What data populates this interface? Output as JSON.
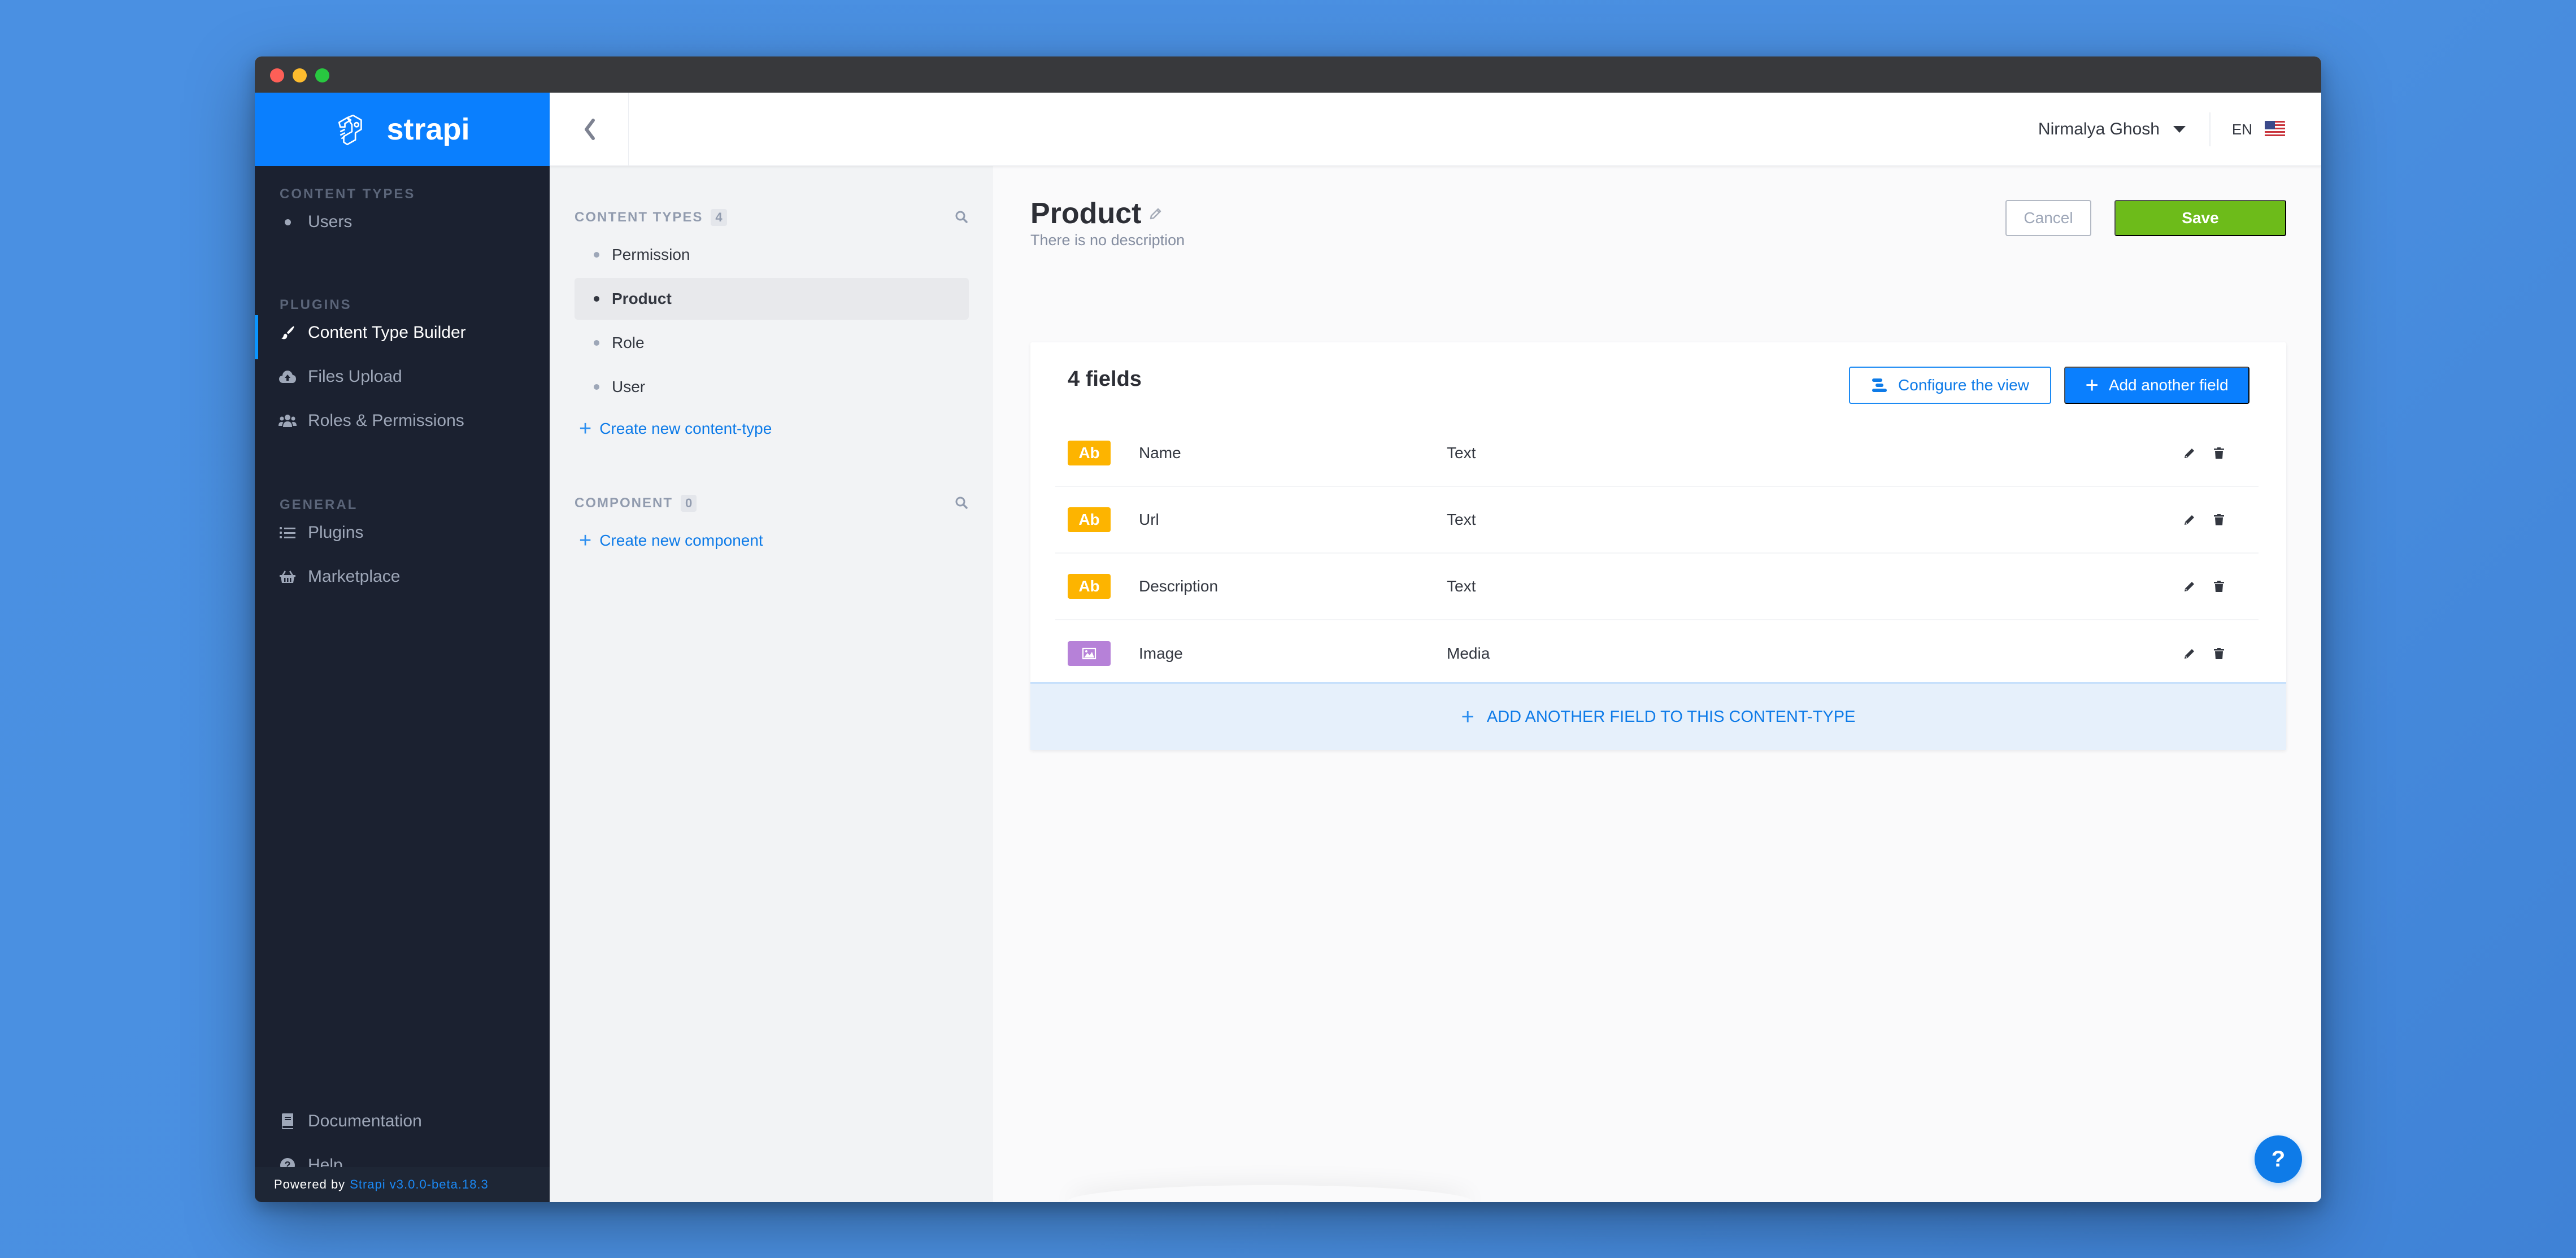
{
  "window": {
    "controls": [
      "close",
      "minimize",
      "maximize"
    ]
  },
  "brand": {
    "name": "strapi",
    "logo_icon": "strapi-logo-icon"
  },
  "sidebar": {
    "sections": [
      {
        "title": "CONTENT TYPES",
        "items": [
          {
            "label": "Users",
            "icon": "bullet-icon",
            "active": false
          }
        ]
      },
      {
        "title": "PLUGINS",
        "items": [
          {
            "label": "Content Type Builder",
            "icon": "paint-brush-icon",
            "active": true
          },
          {
            "label": "Files Upload",
            "icon": "cloud-upload-icon",
            "active": false
          },
          {
            "label": "Roles & Permissions",
            "icon": "users-icon",
            "active": false
          }
        ]
      },
      {
        "title": "GENERAL",
        "items": [
          {
            "label": "Plugins",
            "icon": "list-icon",
            "active": false
          },
          {
            "label": "Marketplace",
            "icon": "basket-icon",
            "active": false
          }
        ]
      }
    ],
    "bottom_items": [
      {
        "label": "Documentation",
        "icon": "book-icon"
      },
      {
        "label": "Help",
        "icon": "question-circle-icon"
      }
    ],
    "footer": {
      "prefix": "Powered by",
      "version_link": "Strapi v3.0.0-beta.18.3"
    }
  },
  "header": {
    "back_icon": "chevron-left-icon",
    "user_name": "Nirmalya Ghosh",
    "language": "EN",
    "flag": "us-flag-icon"
  },
  "content_types_panel": {
    "content_types": {
      "title": "CONTENT TYPES",
      "count": "4",
      "items": [
        {
          "label": "Permission",
          "active": false
        },
        {
          "label": "Product",
          "active": true
        },
        {
          "label": "Role",
          "active": false
        },
        {
          "label": "User",
          "active": false
        }
      ],
      "create_link": "Create new content-type"
    },
    "components": {
      "title": "COMPONENT",
      "count": "0",
      "create_link": "Create new component"
    }
  },
  "main": {
    "title": "Product",
    "description": "There is no description",
    "cancel_label": "Cancel",
    "save_label": "Save",
    "fields_title": "4 fields",
    "configure_label": "Configure the view",
    "add_field_label": "Add another field",
    "fields": [
      {
        "badge": "Ab",
        "badge_kind": "text",
        "name": "Name",
        "type": "Text"
      },
      {
        "badge": "Ab",
        "badge_kind": "text",
        "name": "Url",
        "type": "Text"
      },
      {
        "badge": "Ab",
        "badge_kind": "text",
        "name": "Description",
        "type": "Text"
      },
      {
        "badge": "",
        "badge_kind": "media",
        "name": "Image",
        "type": "Media"
      }
    ],
    "add_field_footer": "ADD ANOTHER FIELD TO THIS CONTENT-TYPE",
    "help_label": "?"
  },
  "colors": {
    "brand_blue": "#0a7ffe",
    "sidebar_bg": "#1b2130",
    "save_green": "#6dbb1a",
    "text_badge": "#fdb400",
    "media_badge": "#b681d8",
    "link_blue": "#0e7be8"
  }
}
